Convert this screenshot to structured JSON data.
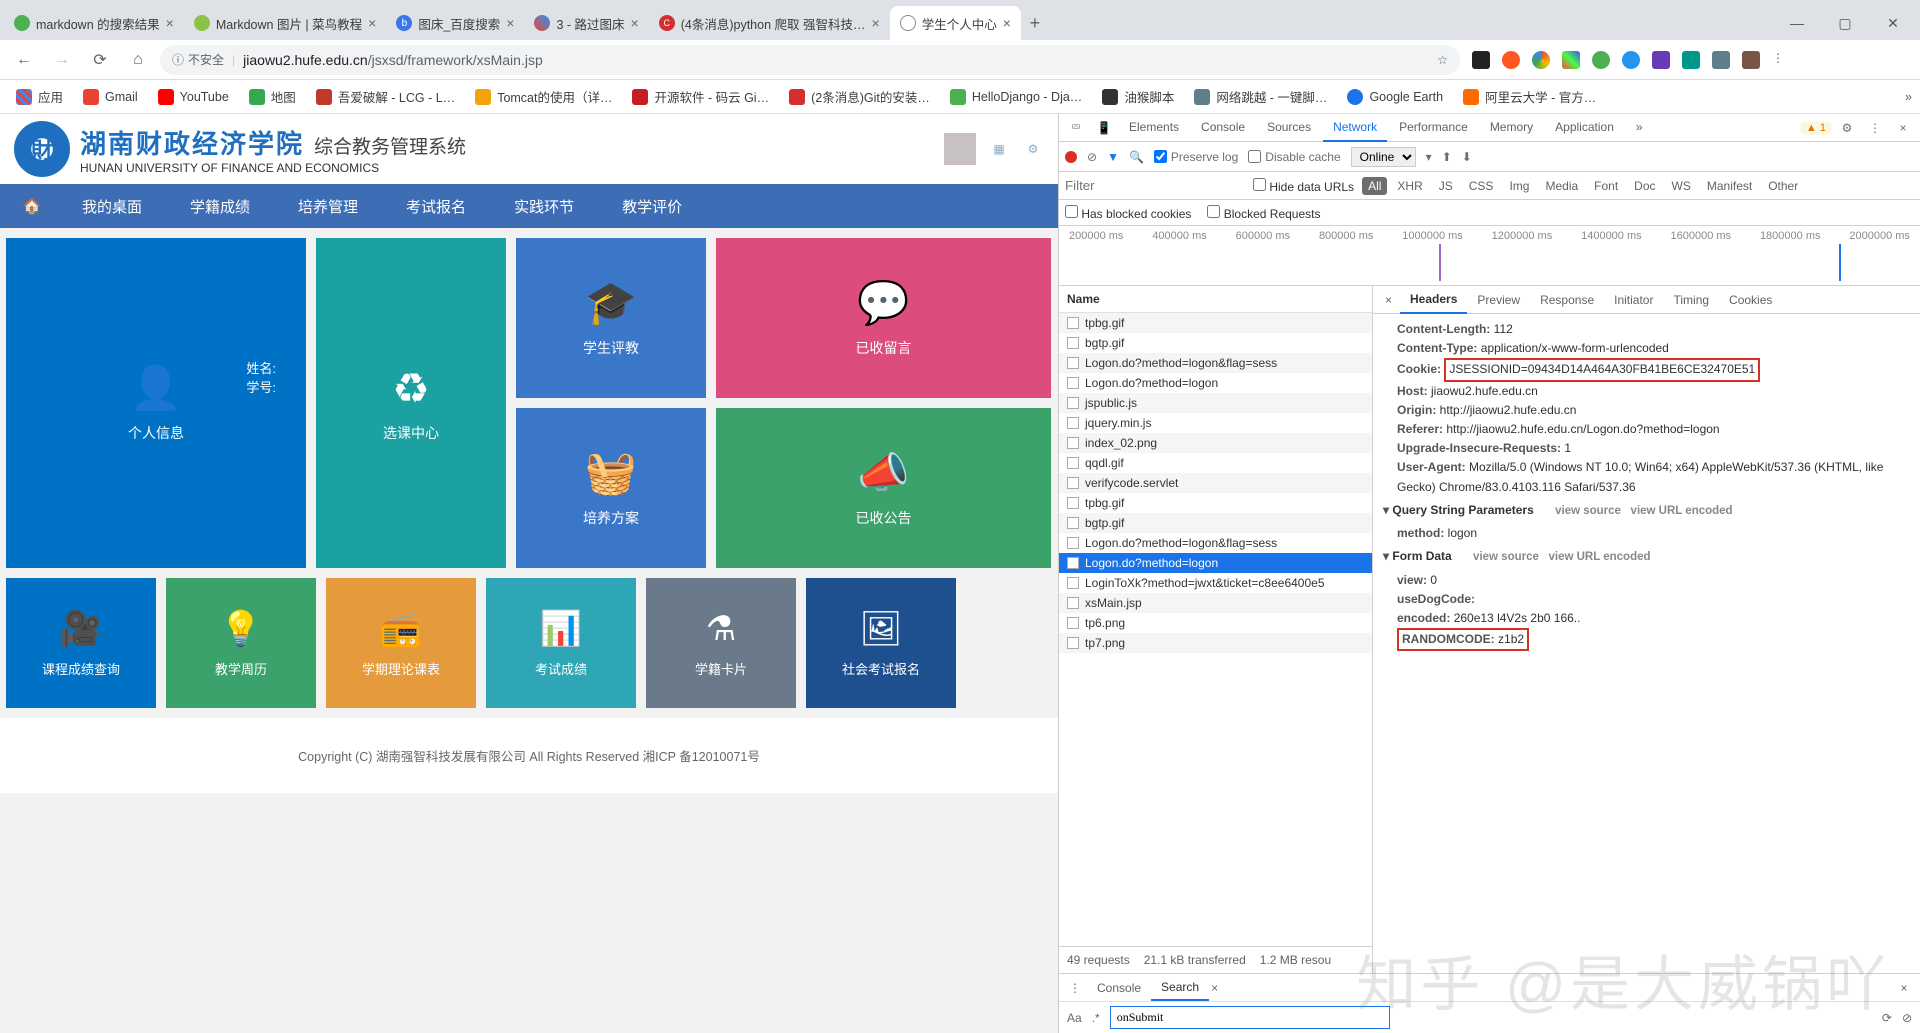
{
  "tabs": [
    {
      "title": "markdown 的搜索结果",
      "fav": "#4caf50"
    },
    {
      "title": "Markdown 图片 | 菜鸟教程",
      "fav": "#8bc34a"
    },
    {
      "title": "图床_百度搜索",
      "fav": "#3b78e7"
    },
    {
      "title": "3 - 路过图床",
      "fav": "#ff5722"
    },
    {
      "title": "(4条消息)python 爬取 强智科技…",
      "fav": "#d32f2f"
    },
    {
      "title": "学生个人中心",
      "fav": "#9e9e9e",
      "active": true
    }
  ],
  "address": {
    "insecure": "不安全",
    "host": "jiaowu2.hufe.edu.cn",
    "path": "/jsxsd/framework/xsMain.jsp"
  },
  "bookmarks": [
    {
      "label": "应用",
      "ico": "#5f6368"
    },
    {
      "label": "Gmail",
      "ico": "#ea4335"
    },
    {
      "label": "YouTube",
      "ico": "#ff0000"
    },
    {
      "label": "地图",
      "ico": "#34a853"
    },
    {
      "label": "吾爱破解 - LCG - L…",
      "ico": "#c0392b"
    },
    {
      "label": "Tomcat的使用（详…",
      "ico": "#f0a30a"
    },
    {
      "label": "开源软件 - 码云 Gi…",
      "ico": "#c71d23"
    },
    {
      "label": "(2条消息)Git的安装…",
      "ico": "#d32f2f"
    },
    {
      "label": "HelloDjango - Dja…",
      "ico": "#4caf50"
    },
    {
      "label": "油猴脚本",
      "ico": "#333"
    },
    {
      "label": "网络跳越 - 一键脚…",
      "ico": "#607d8b"
    },
    {
      "label": "Google Earth",
      "ico": "#1a73e8"
    },
    {
      "label": "阿里云大学 - 官方…",
      "ico": "#ff6a00"
    }
  ],
  "uni": {
    "cn": "湖南财政经济学院",
    "sys": "综合教务管理系统",
    "en": "HUNAN UNIVERSITY OF FINANCE AND ECONOMICS"
  },
  "nav": [
    "我的桌面",
    "学籍成绩",
    "培养管理",
    "考试报名",
    "实践环节",
    "教学评价"
  ],
  "tiles": {
    "personal": "个人信息",
    "name_label": "姓名:",
    "id_label": "学号:",
    "xk": "选课中心",
    "pj": "学生评教",
    "ly": "已收留言",
    "pyfa": "培养方案",
    "gg": "已收公告",
    "row2": [
      "课程成绩查询",
      "教学周历",
      "学期理论课表",
      "考试成绩",
      "学籍卡片",
      "社会考试报名"
    ]
  },
  "footer": "Copyright (C) 湖南强智科技发展有限公司 All Rights Reserved 湘ICP 备12010071号",
  "devtools": {
    "panels": [
      "Elements",
      "Console",
      "Sources",
      "Network",
      "Performance",
      "Memory",
      "Application"
    ],
    "active_panel": "Network",
    "warn": "1",
    "toolbar": {
      "preserve": "Preserve log",
      "disable_cache": "Disable cache",
      "throttle": "Online"
    },
    "filter_placeholder": "Filter",
    "hide_urls": "Hide data URLs",
    "chips": [
      "All",
      "XHR",
      "JS",
      "CSS",
      "Img",
      "Media",
      "Font",
      "Doc",
      "WS",
      "Manifest",
      "Other"
    ],
    "checks": [
      "Has blocked cookies",
      "Blocked Requests"
    ],
    "timeline_ticks": [
      "200000 ms",
      "400000 ms",
      "600000 ms",
      "800000 ms",
      "1000000 ms",
      "1200000 ms",
      "1400000 ms",
      "1600000 ms",
      "1800000 ms",
      "2000000 ms"
    ],
    "name_header": "Name",
    "requests": [
      "tpbg.gif",
      "bgtp.gif",
      "Logon.do?method=logon&flag=sess",
      "Logon.do?method=logon",
      "jspublic.js",
      "jquery.min.js",
      "index_02.png",
      "qqdl.gif",
      "verifycode.servlet",
      "tpbg.gif",
      "bgtp.gif",
      "Logon.do?method=logon&flag=sess",
      "Logon.do?method=logon",
      "LoginToXk?method=jwxt&ticket=c8ee6400e5",
      "xsMain.jsp",
      "tp6.png",
      "tp7.png"
    ],
    "selected_index": 12,
    "status": {
      "requests": "49 requests",
      "transferred": "21.1 kB transferred",
      "resources": "1.2 MB resou"
    },
    "detail_tabs": [
      "Headers",
      "Preview",
      "Response",
      "Initiator",
      "Timing",
      "Cookies"
    ],
    "detail_active": "Headers",
    "headers": {
      "Content-Length": "112",
      "Content-Type": "application/x-www-form-urlencoded",
      "Cookie": "JSESSIONID=09434D14A464A30FB41BE6CE32470E51",
      "Host": "jiaowu2.hufe.edu.cn",
      "Origin": "http://jiaowu2.hufe.edu.cn",
      "Referer": "http://jiaowu2.hufe.edu.cn/Logon.do?method=logon",
      "Upgrade-Insecure-Requests": "1",
      "User-Agent": "Mozilla/5.0 (Windows NT 10.0; Win64; x64) AppleWebKit/537.36 (KHTML, like Gecko) Chrome/83.0.4103.116 Safari/537.36"
    },
    "qsp_title": "Query String Parameters",
    "qsp": {
      "method": "logon"
    },
    "fd_title": "Form Data",
    "fd": {
      "view": "0",
      "useDogCode": "",
      "encoded": "260e13                                                  l4V2s        2b0 166..",
      "RANDOMCODE": "z1b2"
    },
    "view_source": "view source",
    "view_url": "view URL encoded",
    "drawer": {
      "tabs": [
        "Console",
        "Search"
      ],
      "active": "Search",
      "input": "onSubmit"
    }
  },
  "watermark": "知乎 @是大威锅吖"
}
